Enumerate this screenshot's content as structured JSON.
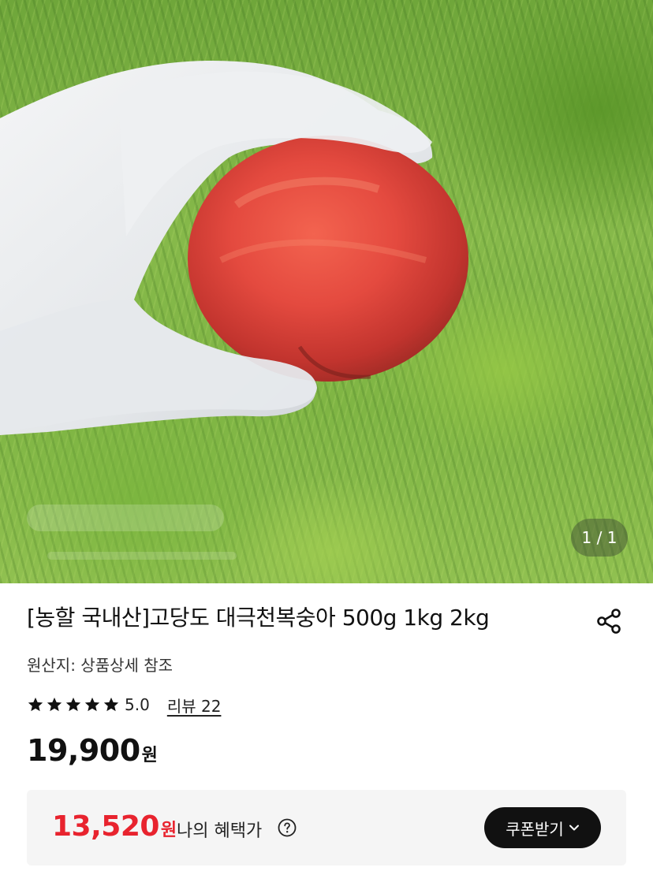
{
  "gallery": {
    "counter": "1 / 1",
    "image_alt": "peach held in gloved hand over grass"
  },
  "product": {
    "title": "[농할 국내산]고당도 대극천복숭아 500g 1kg 2kg",
    "origin": "원산지: 상품상세 참조",
    "rating": "5.0",
    "stars": 5,
    "review_link": "리뷰 22",
    "price": "19,900",
    "price_unit": "원"
  },
  "benefit": {
    "price": "13,520",
    "price_unit": "원",
    "label": "나의 혜택가",
    "coupon_button": "쿠폰받기"
  },
  "colors": {
    "accent_red": "#e8232e",
    "button_dark": "#111111"
  }
}
